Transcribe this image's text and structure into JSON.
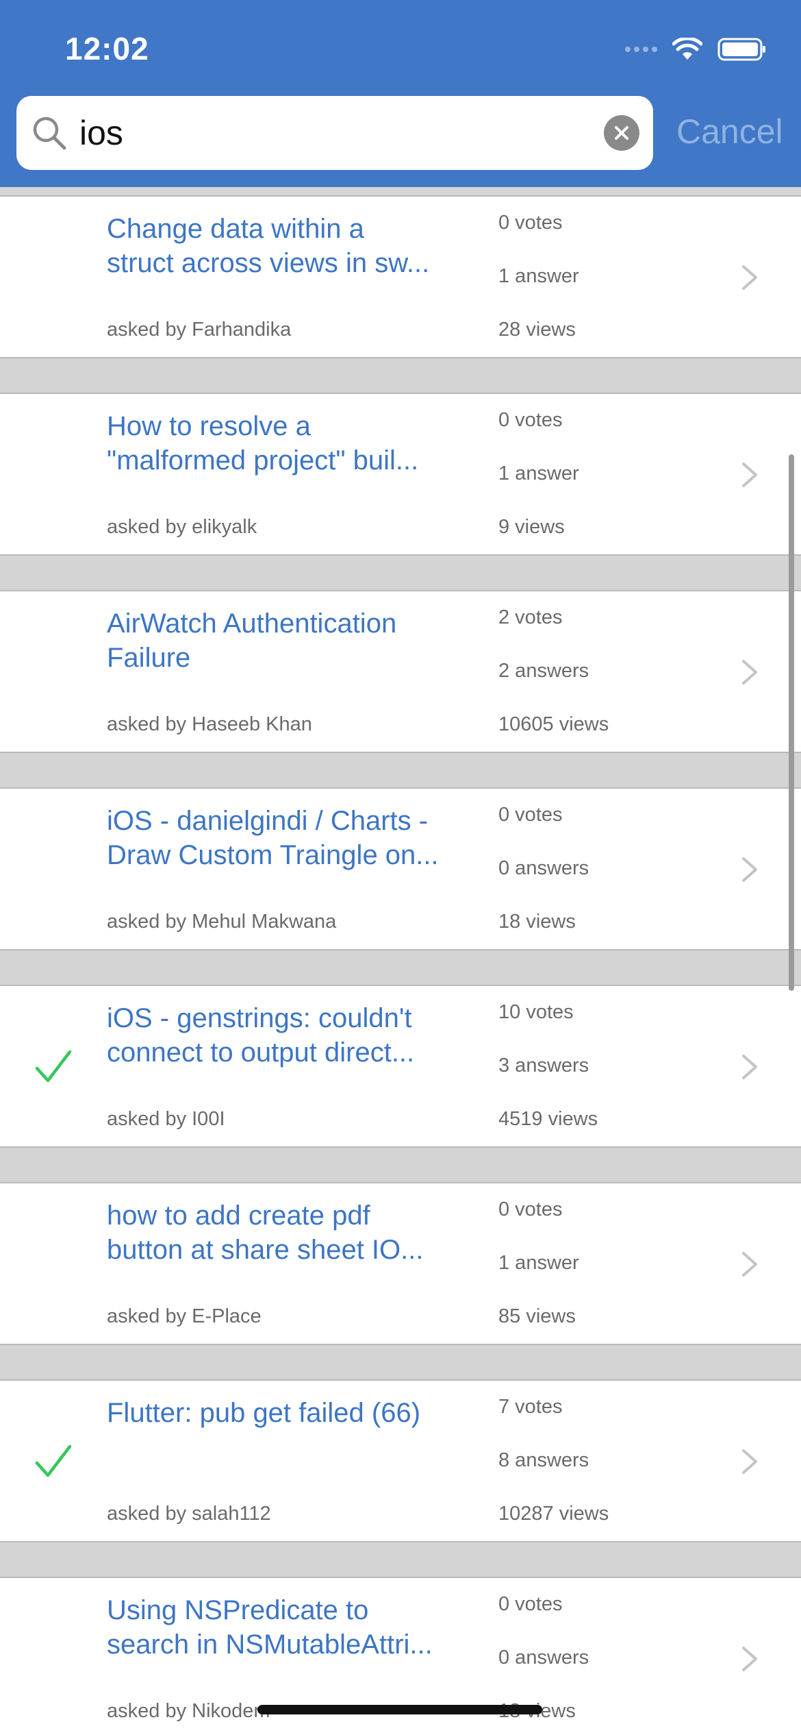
{
  "status_bar": {
    "time": "12:02"
  },
  "search": {
    "query": "ios",
    "cancel_label": "Cancel"
  },
  "questions": [
    {
      "title_line1": "Change data within a",
      "title_line2": "struct across views in sw...",
      "asked_by": "asked by Farhandika",
      "votes": "0 votes",
      "answers": "1 answer",
      "views": "28 views",
      "accepted": false
    },
    {
      "title_line1": "How to resolve a",
      "title_line2": "\"malformed project\" buil...",
      "asked_by": "asked by elikyalk",
      "votes": "0 votes",
      "answers": "1 answer",
      "views": "9 views",
      "accepted": false
    },
    {
      "title_line1": "AirWatch Authentication",
      "title_line2": "Failure",
      "asked_by": "asked by Haseeb Khan",
      "votes": "2 votes",
      "answers": "2 answers",
      "views": "10605 views",
      "accepted": false
    },
    {
      "title_line1": "iOS - danielgindi / Charts -",
      "title_line2": "Draw Custom Traingle on...",
      "asked_by": "asked by Mehul Makwana",
      "votes": "0 votes",
      "answers": "0 answers",
      "views": "18 views",
      "accepted": false
    },
    {
      "title_line1": "iOS - genstrings: couldn't",
      "title_line2": "connect to output direct...",
      "asked_by": "asked by I00I",
      "votes": "10 votes",
      "answers": "3 answers",
      "views": "4519 views",
      "accepted": true
    },
    {
      "title_line1": "how to add create pdf",
      "title_line2": "button at share sheet IO...",
      "asked_by": "asked by E-Place",
      "votes": "0 votes",
      "answers": "1 answer",
      "views": "85 views",
      "accepted": false
    },
    {
      "title_line1": "Flutter: pub get failed (66)",
      "title_line2": "",
      "asked_by": "asked by salah112",
      "votes": "7 votes",
      "answers": "8 answers",
      "views": "10287 views",
      "accepted": true
    },
    {
      "title_line1": "Using NSPredicate to",
      "title_line2": "search in NSMutableAttri...",
      "asked_by": "asked by Nikodem",
      "votes": "0 votes",
      "answers": "0 answers",
      "views": "18 views",
      "accepted": false
    }
  ],
  "colors": {
    "header": "#4077c6",
    "title": "#3d75c4",
    "check": "#34c759",
    "separator": "#d4d4d4"
  }
}
